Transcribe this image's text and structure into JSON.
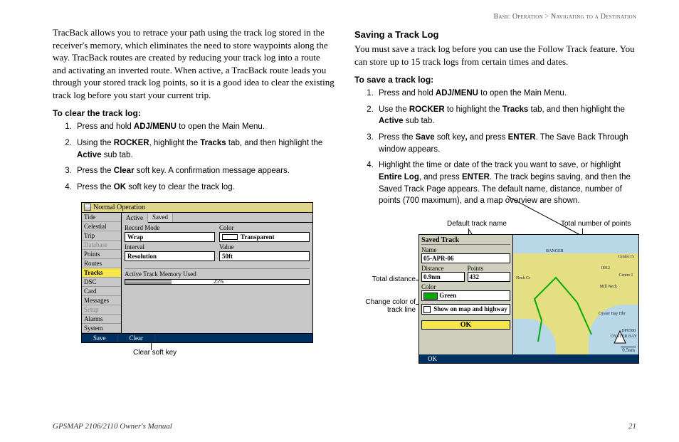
{
  "header": {
    "left": "Basic Operation",
    "sep": ">",
    "right": "Navigating to a Destination"
  },
  "left_col": {
    "intro": "TracBack allows you to retrace your path using the track log stored in the receiver's memory, which eliminates the need to store waypoints along the way. TracBack routes are created by reducing your track log into a route and activating an inverted route. When active, a TracBack route leads you through your stored track log points, so it is a good idea to clear the existing track log before you start your current trip.",
    "task_title": "To clear the track log:",
    "steps": [
      "Press and hold <b>ADJ/MENU</b> to open the Main Menu.",
      "Using the <b>ROCKER</b>, highlight the <b>Tracks</b> tab, and then highlight the <b>Active</b> sub tab.",
      "Press the <b>Clear</b> soft key. A confirmation message appears.",
      "Press the <b>OK</b> soft key to clear the track log."
    ],
    "fig": {
      "title": "Normal Operation",
      "side_items": [
        {
          "t": "Tide",
          "dim": false
        },
        {
          "t": "Celestial",
          "dim": false
        },
        {
          "t": "Trip",
          "dim": false
        },
        {
          "t": "Database",
          "dim": true
        },
        {
          "t": "Points",
          "dim": false
        },
        {
          "t": "Routes",
          "dim": false
        },
        {
          "t": "Tracks",
          "dim": false,
          "hl": true
        },
        {
          "t": "DSC",
          "dim": false
        },
        {
          "t": "Card",
          "dim": false
        },
        {
          "t": "Messages",
          "dim": false
        },
        {
          "t": "Setup",
          "dim": true
        },
        {
          "t": "Alarms",
          "dim": false
        },
        {
          "t": "System",
          "dim": false
        }
      ],
      "tabs": {
        "a": "Active",
        "b": "Saved"
      },
      "labels": {
        "record_mode": "Record Mode",
        "color": "Color",
        "interval": "Interval",
        "value": "Value",
        "memory": "Active Track Memory Used"
      },
      "values": {
        "record_mode": "Wrap",
        "color": "Transparent",
        "interval": "Resolution",
        "value": "50ft",
        "memory_pct": "25%"
      },
      "status": {
        "save": "Save",
        "clear": "Clear"
      },
      "callout": "Clear soft key"
    }
  },
  "right_col": {
    "section_title": "Saving a Track Log",
    "intro": "You must save a track log before you can use the Follow Track feature. You can store up to 15 track logs from certain times and dates.",
    "task_title": "To save a track log:",
    "steps": [
      "Press and hold <b>ADJ/MENU</b> to open the Main Menu.",
      "Use the <b>ROCKER</b> to highlight the <b>Tracks</b> tab, and then highlight the <b>Active</b> sub tab.",
      "Press the <b>Save</b> soft key<b>,</b> and press <b>ENTER</b>. The Save Back Through window appears.",
      "Highlight the time or date of the track you want to save, or highlight <b>Entire Log</b>, and press <b>ENTER</b>. The track begins saving, and then the Saved Track Page appears. The default name, distance, number of points (700 maximum), and a map overview are shown."
    ],
    "fig": {
      "callouts": {
        "default_name": "Default track name",
        "total_points": "Total number of points",
        "total_distance": "Total distance",
        "change_color": "Change color of track line"
      },
      "panel_title": "Saved Track",
      "labels": {
        "name": "Name",
        "distance": "Distance",
        "points": "Points",
        "color": "Color",
        "show": "Show on map and highway"
      },
      "values": {
        "name": "05-APR-06",
        "distance": "0.9nm",
        "points": "432",
        "color": "Green",
        "ok": "OK"
      },
      "status_ok": "OK",
      "map": {
        "labels": [
          "BANGER",
          "Centre I's",
          "Neck Cr",
          "Mill Neck",
          "Oyster Bay Hbr",
          "OYSTER BAY",
          "DP0588",
          "0912",
          "Centre I"
        ],
        "scale": "0.5nm"
      }
    }
  },
  "footer": {
    "left": "GPSMAP 2106/2110 Owner's Manual",
    "right": "21"
  }
}
